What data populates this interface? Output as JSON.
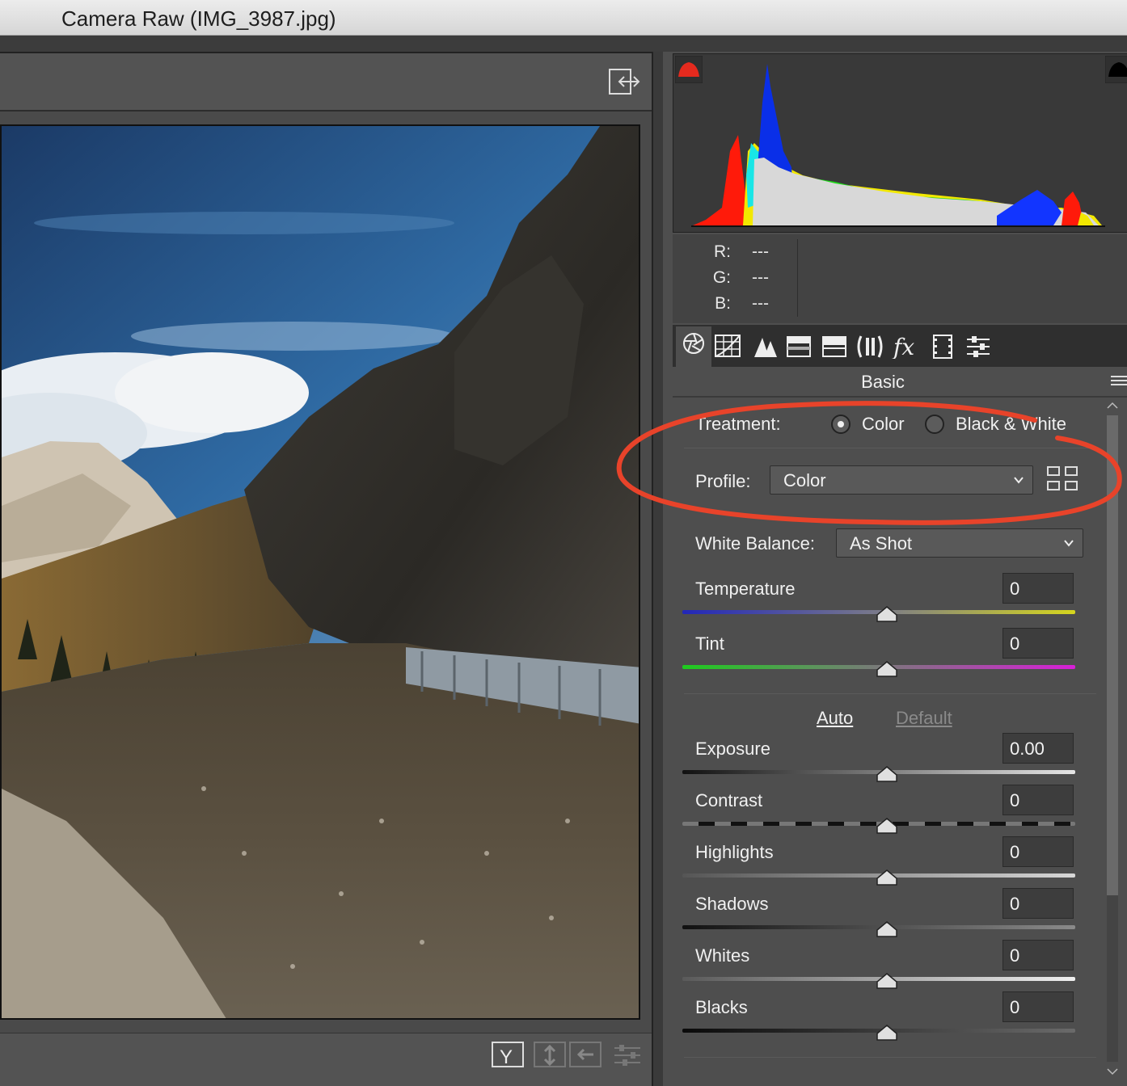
{
  "window": {
    "title": "Camera Raw (IMG_3987.jpg)"
  },
  "readout": {
    "r_label": "R:",
    "r_value": "---",
    "g_label": "G:",
    "g_value": "---",
    "b_label": "B:",
    "b_value": "---"
  },
  "panel": {
    "section_title": "Basic",
    "tabs": [
      "basic-tab",
      "tone-curve-tab",
      "detail-tab",
      "hsl-tab",
      "split-toning-tab",
      "lens-corrections-tab",
      "effects-tab",
      "camera-calibration-tab",
      "presets-tab"
    ],
    "treatment": {
      "label": "Treatment:",
      "option_color": "Color",
      "option_bw": "Black & White",
      "selected": "Color"
    },
    "profile": {
      "label": "Profile:",
      "value": "Color"
    },
    "white_balance": {
      "label": "White Balance:",
      "value": "As Shot"
    },
    "auto_label": "Auto",
    "default_label": "Default",
    "sliders": {
      "temperature": {
        "label": "Temperature",
        "value": "0"
      },
      "tint": {
        "label": "Tint",
        "value": "0"
      },
      "exposure": {
        "label": "Exposure",
        "value": "0.00"
      },
      "contrast": {
        "label": "Contrast",
        "value": "0"
      },
      "highlights": {
        "label": "Highlights",
        "value": "0"
      },
      "shadows": {
        "label": "Shadows",
        "value": "0"
      },
      "whites": {
        "label": "Whites",
        "value": "0"
      },
      "blacks": {
        "label": "Blacks",
        "value": "0"
      }
    }
  },
  "colors": {
    "annotation": "#e8432a",
    "panel_bg": "#4e4e4e",
    "clip_warning_shadow": "#e52a1e"
  }
}
